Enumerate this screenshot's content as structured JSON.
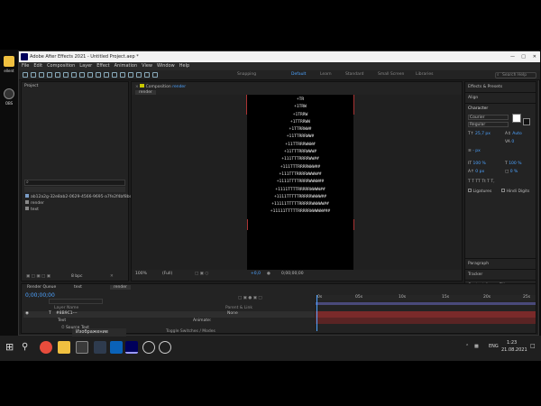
{
  "desktop": {
    "labels": [
      "ellent",
      "OBS"
    ]
  },
  "window": {
    "title": "Adobe After Effects 2021 - Untitled Project.aep *"
  },
  "menu": [
    "File",
    "Edit",
    "Composition",
    "Layer",
    "Effect",
    "Animation",
    "View",
    "Window",
    "Help"
  ],
  "workspaces": [
    "Snapping",
    "Default",
    "Learn",
    "Standard",
    "Small Screen",
    "Libraries"
  ],
  "search_placeholder": "Search Help",
  "project": {
    "tab": "Project",
    "items": [
      "ab12a2g-32e8ab2-0629-4566-9695-a7fe2f4bf8bd.png",
      "render",
      "text"
    ],
    "bpc": "8 bpc"
  },
  "composition": {
    "tab_prefix": "Composition",
    "tab_name": "render",
    "sub_tab": "render",
    "zoom": "100%",
    "resolution": "(Full)",
    "exposure": "+0,0",
    "timecode": "0;00;00;00"
  },
  "ascii_art": [
    "+TR",
    "+1TRW",
    "+1TRRW",
    "+1TTRRWW",
    "+1TTRRWW#",
    "+11TTRRRWW#",
    "+11TTRRRWWW#",
    "+11TTTRRRWWW#",
    "+111TTTRRRRWW##",
    "+111TTTRRRRWWW##",
    "+111TTTRRRRWWWW##",
    "+1111TTTTRRRRWWWW##",
    "+1111TTTTRRRRRWWWW##",
    "+1111TTTTTRRRRRWWWW##",
    "+11111TTTTTRRRRRWWWWW##",
    "+11111TTTTTRRRRRWWWWW###"
  ],
  "right_panel": {
    "items": [
      "Effects & Presets",
      "Align",
      "Character"
    ],
    "font": "Courier",
    "style": "Regular",
    "size": "25,7 px",
    "leading": "Auto",
    "tracking": "0",
    "stroke": "- px",
    "scale_v": "100 %",
    "scale_h": "100 %",
    "baseline": "0 px",
    "tsume": "0 %",
    "ligatures": "Ligatures",
    "hindi": "Hindi Digits",
    "lower": [
      "Paragraph",
      "Tracker",
      "Content-Aware Fill",
      "Libraries"
    ]
  },
  "timeline": {
    "tabs": [
      "Render Queue",
      "text",
      "render"
    ],
    "timecode": "0;00;00;00",
    "layer_name": "#8B9C1---",
    "layer_sub": "Text",
    "source_text": "Source Text",
    "animate": "Animate:",
    "parent": "None",
    "col_headers": [
      "Layer Name",
      "Parent & Link"
    ],
    "ruler": [
      "0s",
      "05s",
      "10s",
      "15s",
      "20s",
      "25s"
    ],
    "footer": "Toggle Switches / Modes"
  },
  "taskbar": {
    "tooltip": "Изображение",
    "lang": "ENG",
    "time": "1:23",
    "date": "21.08.2021"
  }
}
